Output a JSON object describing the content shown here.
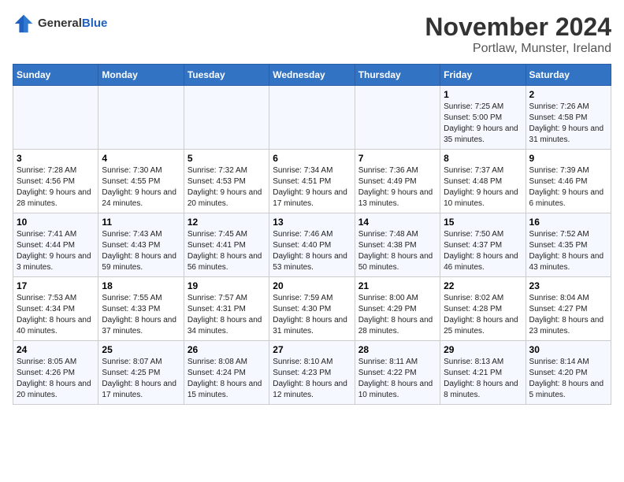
{
  "logo": {
    "general": "General",
    "blue": "Blue"
  },
  "title": "November 2024",
  "subtitle": "Portlaw, Munster, Ireland",
  "weekdays": [
    "Sunday",
    "Monday",
    "Tuesday",
    "Wednesday",
    "Thursday",
    "Friday",
    "Saturday"
  ],
  "weeks": [
    [
      {
        "day": "",
        "info": ""
      },
      {
        "day": "",
        "info": ""
      },
      {
        "day": "",
        "info": ""
      },
      {
        "day": "",
        "info": ""
      },
      {
        "day": "",
        "info": ""
      },
      {
        "day": "1",
        "info": "Sunrise: 7:25 AM\nSunset: 5:00 PM\nDaylight: 9 hours and 35 minutes."
      },
      {
        "day": "2",
        "info": "Sunrise: 7:26 AM\nSunset: 4:58 PM\nDaylight: 9 hours and 31 minutes."
      }
    ],
    [
      {
        "day": "3",
        "info": "Sunrise: 7:28 AM\nSunset: 4:56 PM\nDaylight: 9 hours and 28 minutes."
      },
      {
        "day": "4",
        "info": "Sunrise: 7:30 AM\nSunset: 4:55 PM\nDaylight: 9 hours and 24 minutes."
      },
      {
        "day": "5",
        "info": "Sunrise: 7:32 AM\nSunset: 4:53 PM\nDaylight: 9 hours and 20 minutes."
      },
      {
        "day": "6",
        "info": "Sunrise: 7:34 AM\nSunset: 4:51 PM\nDaylight: 9 hours and 17 minutes."
      },
      {
        "day": "7",
        "info": "Sunrise: 7:36 AM\nSunset: 4:49 PM\nDaylight: 9 hours and 13 minutes."
      },
      {
        "day": "8",
        "info": "Sunrise: 7:37 AM\nSunset: 4:48 PM\nDaylight: 9 hours and 10 minutes."
      },
      {
        "day": "9",
        "info": "Sunrise: 7:39 AM\nSunset: 4:46 PM\nDaylight: 9 hours and 6 minutes."
      }
    ],
    [
      {
        "day": "10",
        "info": "Sunrise: 7:41 AM\nSunset: 4:44 PM\nDaylight: 9 hours and 3 minutes."
      },
      {
        "day": "11",
        "info": "Sunrise: 7:43 AM\nSunset: 4:43 PM\nDaylight: 8 hours and 59 minutes."
      },
      {
        "day": "12",
        "info": "Sunrise: 7:45 AM\nSunset: 4:41 PM\nDaylight: 8 hours and 56 minutes."
      },
      {
        "day": "13",
        "info": "Sunrise: 7:46 AM\nSunset: 4:40 PM\nDaylight: 8 hours and 53 minutes."
      },
      {
        "day": "14",
        "info": "Sunrise: 7:48 AM\nSunset: 4:38 PM\nDaylight: 8 hours and 50 minutes."
      },
      {
        "day": "15",
        "info": "Sunrise: 7:50 AM\nSunset: 4:37 PM\nDaylight: 8 hours and 46 minutes."
      },
      {
        "day": "16",
        "info": "Sunrise: 7:52 AM\nSunset: 4:35 PM\nDaylight: 8 hours and 43 minutes."
      }
    ],
    [
      {
        "day": "17",
        "info": "Sunrise: 7:53 AM\nSunset: 4:34 PM\nDaylight: 8 hours and 40 minutes."
      },
      {
        "day": "18",
        "info": "Sunrise: 7:55 AM\nSunset: 4:33 PM\nDaylight: 8 hours and 37 minutes."
      },
      {
        "day": "19",
        "info": "Sunrise: 7:57 AM\nSunset: 4:31 PM\nDaylight: 8 hours and 34 minutes."
      },
      {
        "day": "20",
        "info": "Sunrise: 7:59 AM\nSunset: 4:30 PM\nDaylight: 8 hours and 31 minutes."
      },
      {
        "day": "21",
        "info": "Sunrise: 8:00 AM\nSunset: 4:29 PM\nDaylight: 8 hours and 28 minutes."
      },
      {
        "day": "22",
        "info": "Sunrise: 8:02 AM\nSunset: 4:28 PM\nDaylight: 8 hours and 25 minutes."
      },
      {
        "day": "23",
        "info": "Sunrise: 8:04 AM\nSunset: 4:27 PM\nDaylight: 8 hours and 23 minutes."
      }
    ],
    [
      {
        "day": "24",
        "info": "Sunrise: 8:05 AM\nSunset: 4:26 PM\nDaylight: 8 hours and 20 minutes."
      },
      {
        "day": "25",
        "info": "Sunrise: 8:07 AM\nSunset: 4:25 PM\nDaylight: 8 hours and 17 minutes."
      },
      {
        "day": "26",
        "info": "Sunrise: 8:08 AM\nSunset: 4:24 PM\nDaylight: 8 hours and 15 minutes."
      },
      {
        "day": "27",
        "info": "Sunrise: 8:10 AM\nSunset: 4:23 PM\nDaylight: 8 hours and 12 minutes."
      },
      {
        "day": "28",
        "info": "Sunrise: 8:11 AM\nSunset: 4:22 PM\nDaylight: 8 hours and 10 minutes."
      },
      {
        "day": "29",
        "info": "Sunrise: 8:13 AM\nSunset: 4:21 PM\nDaylight: 8 hours and 8 minutes."
      },
      {
        "day": "30",
        "info": "Sunrise: 8:14 AM\nSunset: 4:20 PM\nDaylight: 8 hours and 5 minutes."
      }
    ]
  ]
}
